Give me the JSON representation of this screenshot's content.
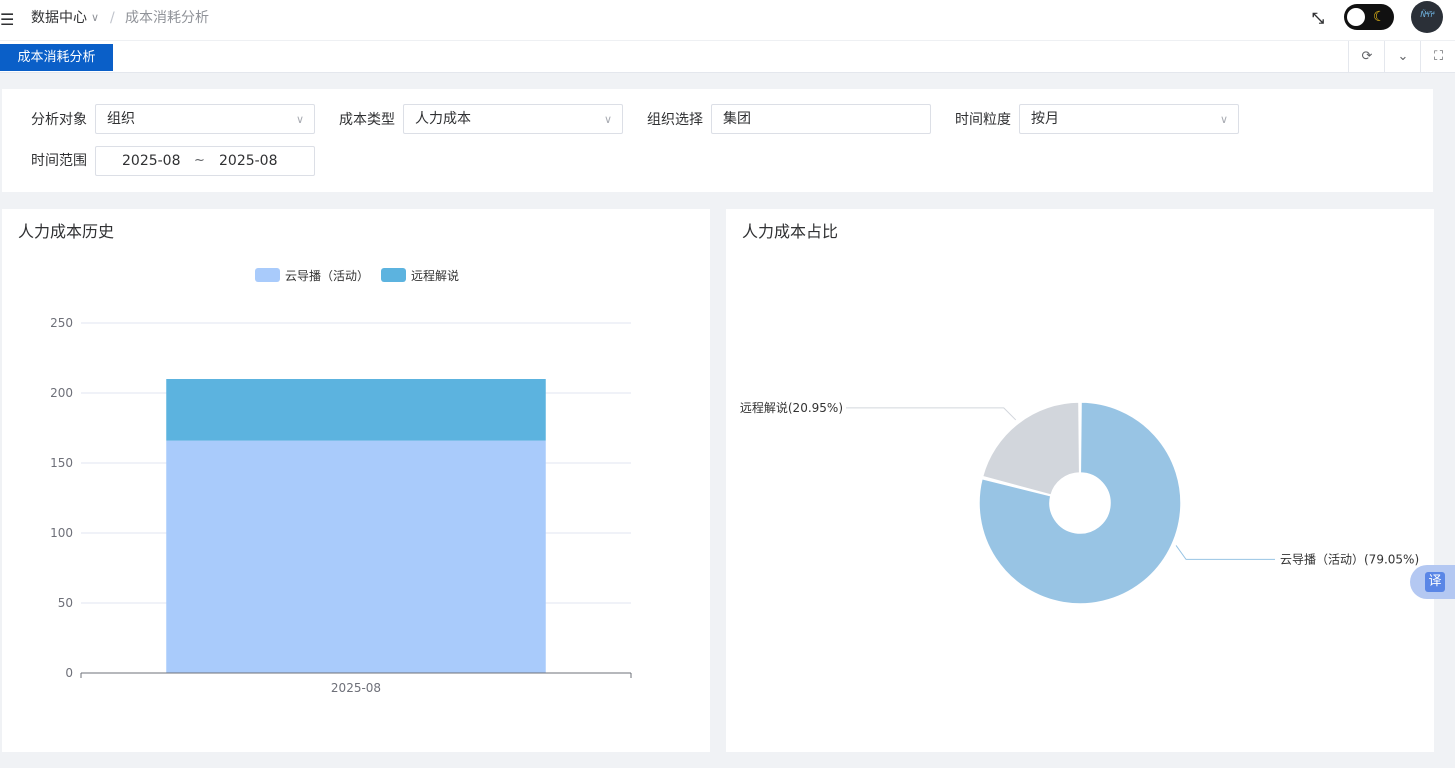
{
  "header": {
    "menu_icon": "menu-fold-icon",
    "breadcrumb": [
      "数据中心",
      "成本消耗分析"
    ],
    "breadcrumb_separator": "/",
    "fullscreen_icon": "fullscreen-icon",
    "theme_toggle_icon": "moon-icon",
    "avatar_text": "Ñ⁴ñ⁴"
  },
  "tabs": {
    "items": [
      {
        "label": "成本消耗分析",
        "active": true
      }
    ],
    "active_color": "#0a5fc8",
    "tools": [
      "refresh-icon",
      "chevron-down-icon",
      "maximize-icon"
    ]
  },
  "filters": {
    "analysis_object": {
      "label": "分析对象",
      "value": "组织"
    },
    "cost_type": {
      "label": "成本类型",
      "value": "人力成本"
    },
    "org_select": {
      "label": "组织选择",
      "value": "集团"
    },
    "time_granularity": {
      "label": "时间粒度",
      "value": "按月"
    },
    "time_range": {
      "label": "时间范围",
      "start": "2025-08",
      "separator": "~",
      "end": "2025-08"
    }
  },
  "history_chart": {
    "title": "人力成本历史"
  },
  "ratio_chart": {
    "title": "人力成本占比"
  },
  "translate_button": {
    "label": "译"
  },
  "chart_data": [
    {
      "type": "bar",
      "stacked": true,
      "categories": [
        "2025-08"
      ],
      "series": [
        {
          "name": "云导播（活动）",
          "values": [
            166
          ],
          "color": "#a9cbfb"
        },
        {
          "name": "远程解说",
          "values": [
            44
          ],
          "color": "#5cb3df"
        }
      ],
      "ylim": [
        0,
        250
      ],
      "yticks": [
        0,
        50,
        100,
        150,
        200,
        250
      ],
      "grid": true,
      "legend": "top-center"
    },
    {
      "type": "pie",
      "donut": true,
      "slices": [
        {
          "label": "远程解说(20.95%)",
          "value": 20.95,
          "color": "#d2d6dc"
        },
        {
          "label": "云导播（活动）(79.05%)",
          "value": 79.05,
          "color": "#98c4e4"
        }
      ],
      "legend": "none"
    }
  ]
}
